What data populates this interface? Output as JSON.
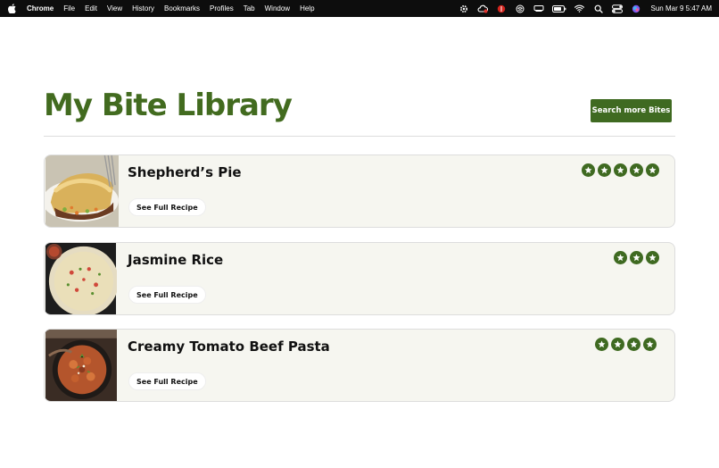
{
  "menubar": {
    "app": "Chrome",
    "items": [
      "File",
      "Edit",
      "View",
      "History",
      "Bookmarks",
      "Profiles",
      "Tab",
      "Window",
      "Help"
    ],
    "status_icons": [
      "gear-icon",
      "creative-cloud-icon",
      "red-app-icon",
      "layers-icon",
      "display-icon",
      "battery-icon",
      "wifi-icon",
      "search-icon",
      "control-center-icon",
      "siri-icon"
    ],
    "clock": "Sun Mar 9  5:47 AM"
  },
  "page": {
    "title": "My Bite Library",
    "search_button": "Search more Bites",
    "accent_color": "#3f6a21"
  },
  "recipes": [
    {
      "name": "Shepherd’s Pie",
      "button": "See Full Recipe",
      "rating": 5
    },
    {
      "name": "Jasmine Rice",
      "button": "See Full Recipe",
      "rating": 3
    },
    {
      "name": "Creamy Tomato Beef Pasta",
      "button": "See Full Recipe",
      "rating": 4
    }
  ]
}
